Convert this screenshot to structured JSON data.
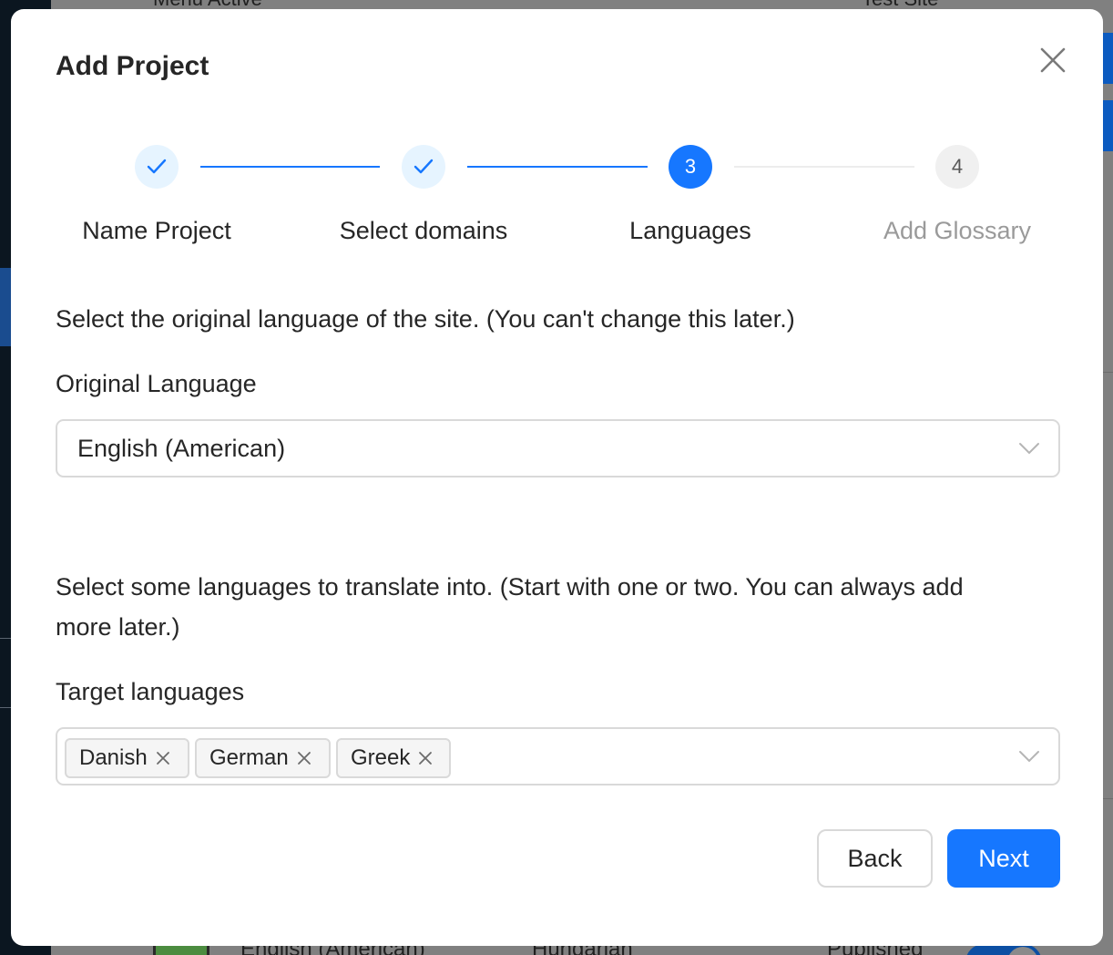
{
  "background": {
    "top_texts": [
      "Menu Active",
      "Test Site"
    ],
    "bottom_texts": [
      "English (American)",
      "Hungarian",
      "Published"
    ]
  },
  "modal": {
    "title": "Add Project",
    "close_icon": "close-icon"
  },
  "steps": [
    {
      "label": "Name Project",
      "status": "done",
      "icon": "check-icon"
    },
    {
      "label": "Select domains",
      "status": "done",
      "icon": "check-icon"
    },
    {
      "label": "Languages",
      "status": "current",
      "number": "3"
    },
    {
      "label": "Add Glossary",
      "status": "pending",
      "number": "4"
    }
  ],
  "original": {
    "instruction": "Select the original language of the site. (You can't change this later.)",
    "label": "Original Language",
    "value": "English (American)"
  },
  "target": {
    "instruction_line1": "Select some languages to translate into. (Start with one or two. You can always add",
    "instruction_line2": "more later.)",
    "label": "Target languages",
    "tags": [
      "Danish",
      "German",
      "Greek"
    ]
  },
  "buttons": {
    "back": "Back",
    "next": "Next"
  },
  "colors": {
    "primary": "#1677ff",
    "primary_light": "#e6f4ff",
    "border": "#d9d9d9",
    "text": "#262626",
    "muted": "#9a9a9a"
  }
}
